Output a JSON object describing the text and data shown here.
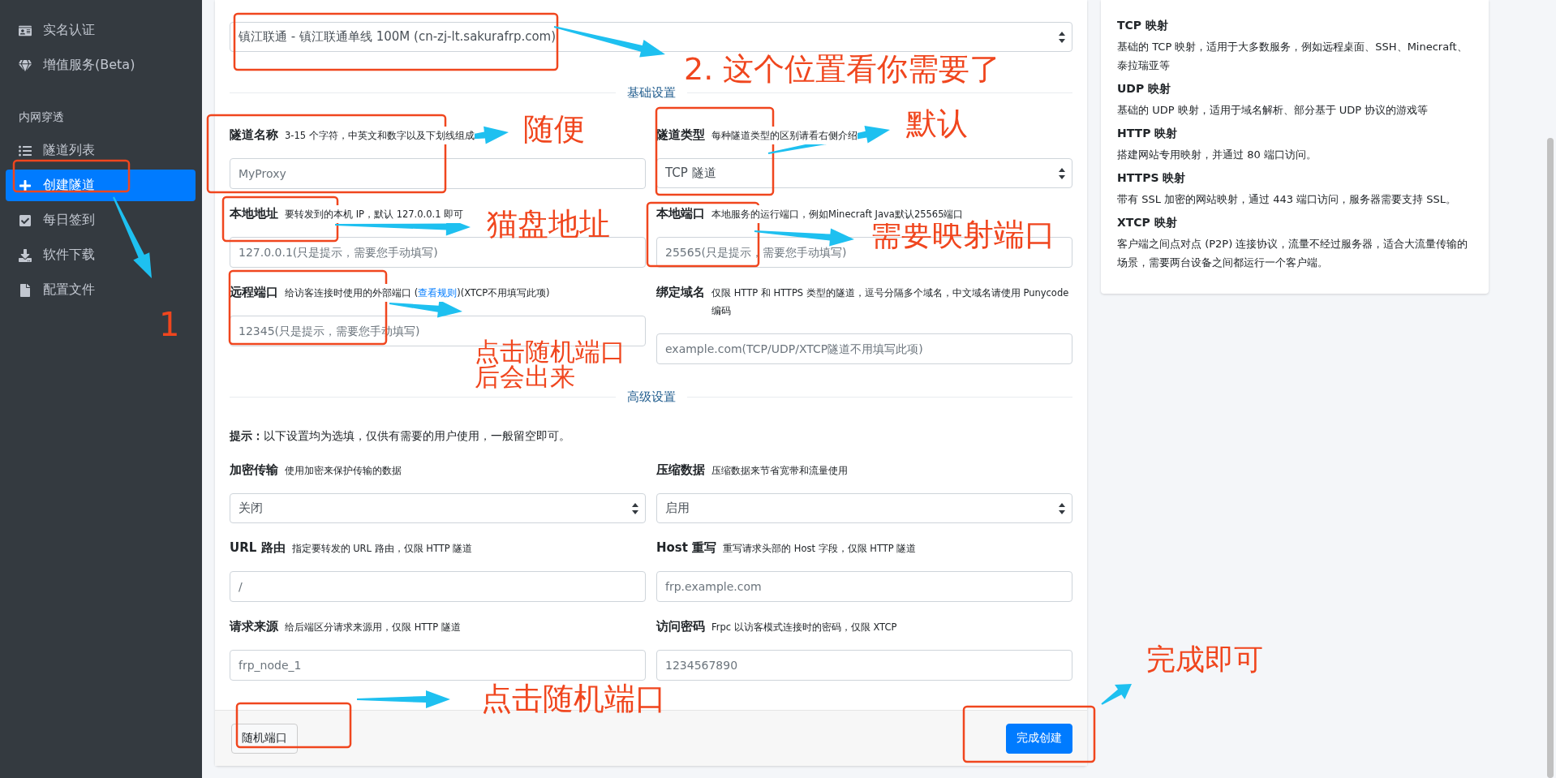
{
  "sidebar": {
    "items": [
      {
        "label": "实名认证",
        "selected": false
      },
      {
        "label": "增值服务(Beta)",
        "selected": false
      }
    ],
    "section": "内网穿透",
    "section_items": [
      {
        "label": "隧道列表",
        "selected": false
      },
      {
        "label": "创建隧道",
        "selected": true
      },
      {
        "label": "每日签到",
        "selected": false
      },
      {
        "label": "软件下载",
        "selected": false
      },
      {
        "label": "配置文件",
        "selected": false
      }
    ]
  },
  "form": {
    "server_select": {
      "value": "镇江联通 - 镇江联通单线 100M (cn-zj-lt.sakurafrp.com)"
    },
    "basic_title": "基础设置",
    "basic_fields": [
      {
        "label": "隧道名称",
        "help": "3-15 个字符，中英文和数字以及下划线组成",
        "kind": "input",
        "placeholder": "MyProxy"
      },
      {
        "label": "隧道类型",
        "help": "每种隧道类型的区别请看右侧介绍",
        "kind": "select",
        "value": "TCP 隧道"
      },
      {
        "label": "本地地址",
        "help": "要转发到的本机 IP，默认 127.0.0.1 即可",
        "kind": "input",
        "placeholder": "127.0.0.1(只是提示，需要您手动填写)"
      },
      {
        "label": "本地端口",
        "help": "本地服务的运行端口，例如Minecraft Java默认25565端口",
        "kind": "input",
        "placeholder": "25565(只是提示，需要您手动填写)"
      },
      {
        "label": "远程端口",
        "help": "给访客连接时使用的外部端口 (",
        "link": "查看规则",
        "help_after": ")(XTCP不用填写此项)",
        "kind": "input",
        "placeholder": "12345(只是提示，需要您手动填写)"
      },
      {
        "label": "绑定域名",
        "help": "仅限 HTTP 和 HTTPS 类型的隧道，逗号分隔多个域名，中文域名请使用 Punycode编码",
        "kind": "input",
        "placeholder": "example.com(TCP/UDP/XTCP隧道不用填写此项)"
      }
    ],
    "advanced_title": "高级设置",
    "advanced_note": "**提示：**以下设置均为选填，仅供有需要的用户使用，一般留空即可。",
    "advanced_fields": [
      {
        "label": "加密传输",
        "help": "使用加密来保护传输的数据",
        "kind": "select",
        "value": "关闭"
      },
      {
        "label": "压缩数据",
        "help": "压缩数据来节省宽带和流量使用",
        "kind": "select",
        "value": "启用"
      },
      {
        "label": "URL 路由",
        "help": "指定要转发的 URL 路由，仅限 HTTP 隧道",
        "kind": "input",
        "placeholder": "/"
      },
      {
        "label": "Host 重写",
        "help": "重写请求头部的 Host 字段，仅限 HTTP 隧道",
        "kind": "input",
        "placeholder": "frp.example.com"
      },
      {
        "label": "请求来源",
        "help": "给后端区分请求来源用，仅限 HTTP 隧道",
        "kind": "input",
        "placeholder": "frp_node_1"
      },
      {
        "label": "访问密码",
        "help": "Frpc 以访客模式连接时的密码，仅限 XTCP",
        "kind": "input",
        "placeholder": "1234567890"
      }
    ],
    "random_button": "随机端口",
    "submit_button": "完成创建"
  },
  "info_panel": [
    {
      "title": "TCP 映射",
      "text": "基础的 TCP 映射，适用于大多数服务，例如远程桌面、SSH、Minecraft、泰拉瑞亚等"
    },
    {
      "title": "UDP 映射",
      "text": "基础的 UDP 映射，适用于域名解析、部分基于 UDP 协议的游戏等"
    },
    {
      "title": "HTTP 映射",
      "text": "搭建网站专用映射，并通过 80 端口访问。"
    },
    {
      "title": "HTTPS 映射",
      "text": "带有 SSL 加密的网站映射，通过 443 端口访问，服务器需要支持 SSL。"
    },
    {
      "title": "XTCP 映射",
      "text": "客户端之间点对点 (P2P) 连接协议，流量不经过服务器，适合大流量传输的场景，需要两台设备之间都运行一个客户端。"
    }
  ],
  "annotations": [
    "1",
    "2. 这个位置看你需要了",
    "随便",
    "默认",
    "猫盘地址",
    "需要映射端口",
    "点击随机端口后会出来",
    "点击随机端口",
    "完成即可"
  ]
}
